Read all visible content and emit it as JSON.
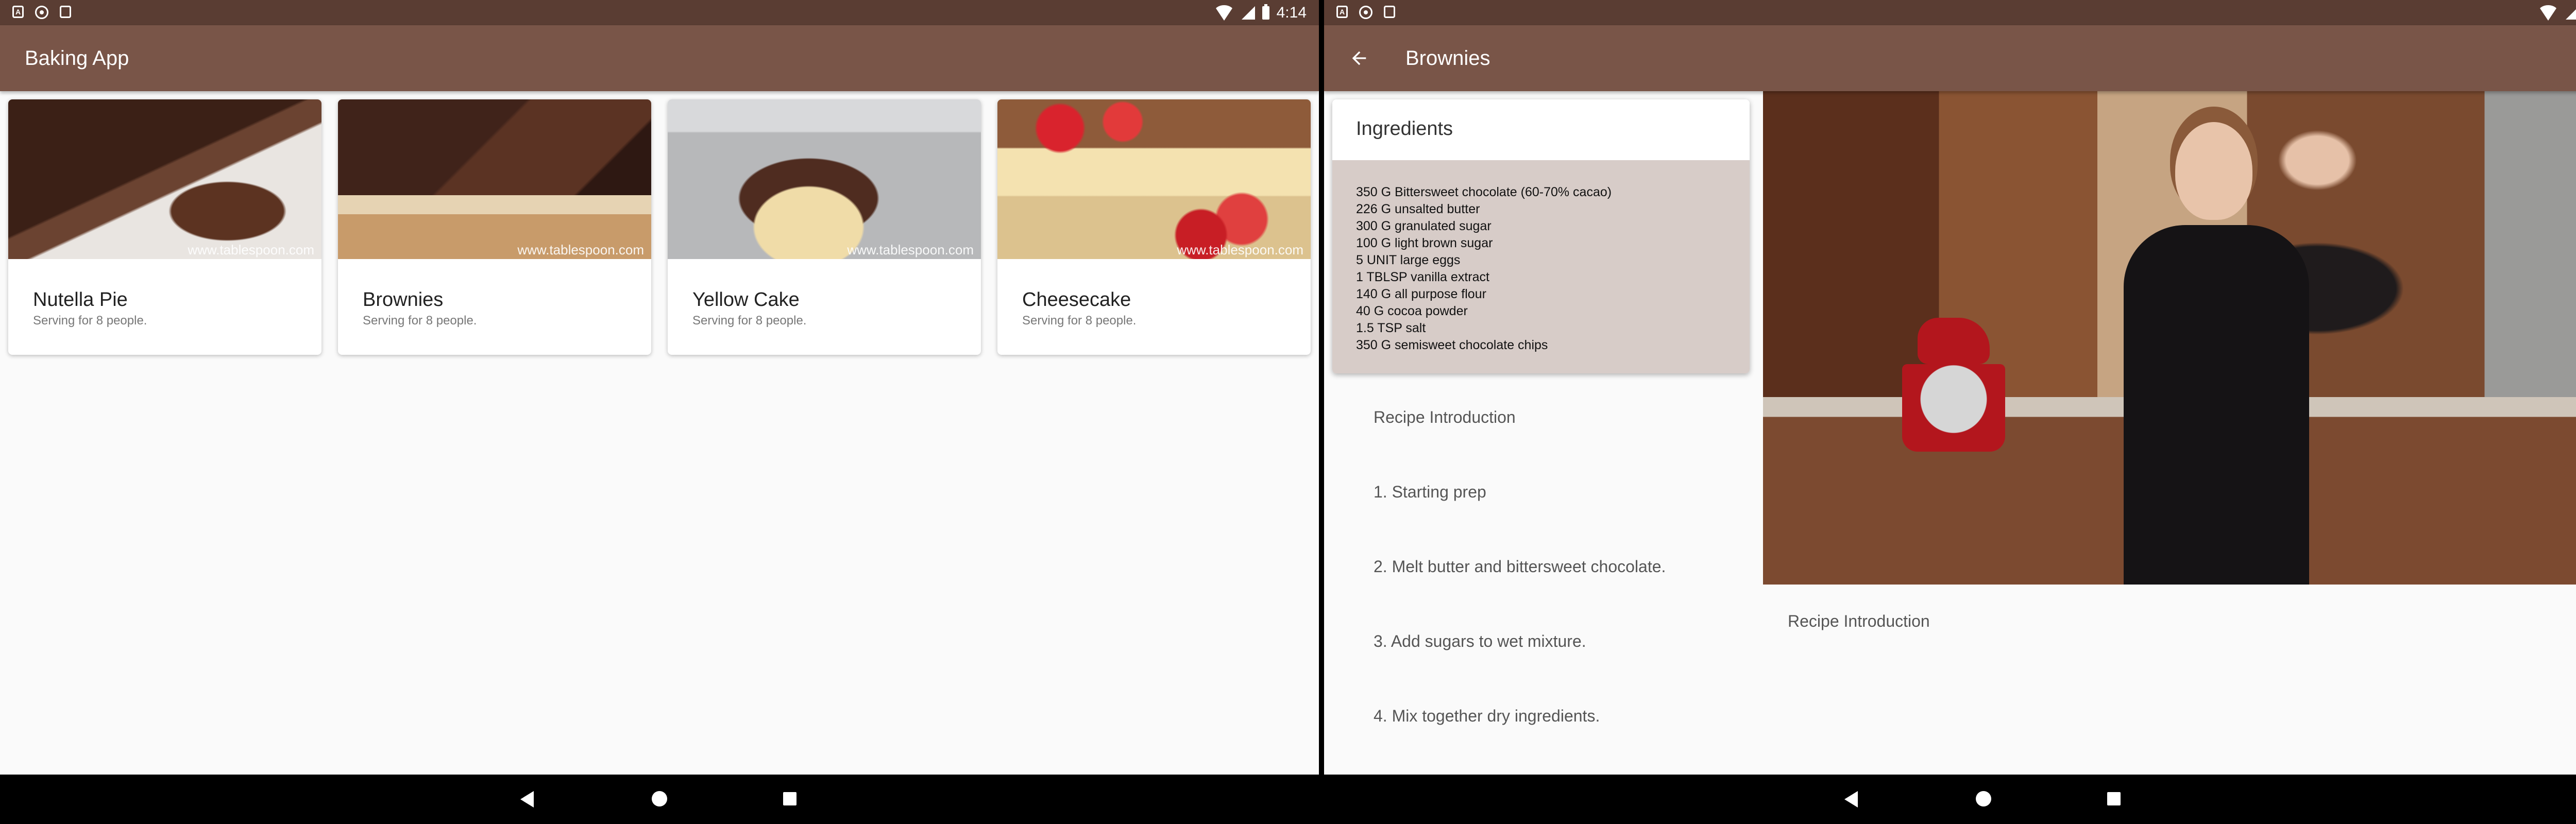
{
  "status_bar": {
    "time": "4:14"
  },
  "left": {
    "app_title": "Baking App",
    "recipes": [
      {
        "name": "Nutella Pie",
        "serving": "Serving for 8 people.",
        "watermark": "www.tablespoon.com"
      },
      {
        "name": "Brownies",
        "serving": "Serving for 8 people.",
        "watermark": "www.tablespoon.com"
      },
      {
        "name": "Yellow Cake",
        "serving": "Serving for 8 people.",
        "watermark": "www.tablespoon.com"
      },
      {
        "name": "Cheesecake",
        "serving": "Serving for 8 people.",
        "watermark": "www.tablespoon.com"
      }
    ]
  },
  "right": {
    "title": "Brownies",
    "ingredients_title": "Ingredients",
    "ingredients": [
      "350 G Bittersweet chocolate (60-70% cacao)",
      "226 G unsalted butter",
      "300 G granulated sugar",
      "100 G light brown sugar",
      "5 UNIT large eggs",
      "1 TBLSP vanilla extract",
      "140 G all purpose flour",
      "40 G cocoa powder",
      "1.5 TSP salt",
      "350 G semisweet chocolate chips"
    ],
    "steps": [
      "Recipe Introduction",
      "1. Starting prep",
      "2. Melt butter and bittersweet chocolate.",
      "3. Add sugars to wet mixture.",
      "4. Mix together dry ingredients."
    ],
    "video_caption": "Recipe Introduction"
  },
  "colors": {
    "status_bar": "#5a3d33",
    "app_bar": "#795548",
    "ingredients_bg": "#d7ccc8"
  }
}
